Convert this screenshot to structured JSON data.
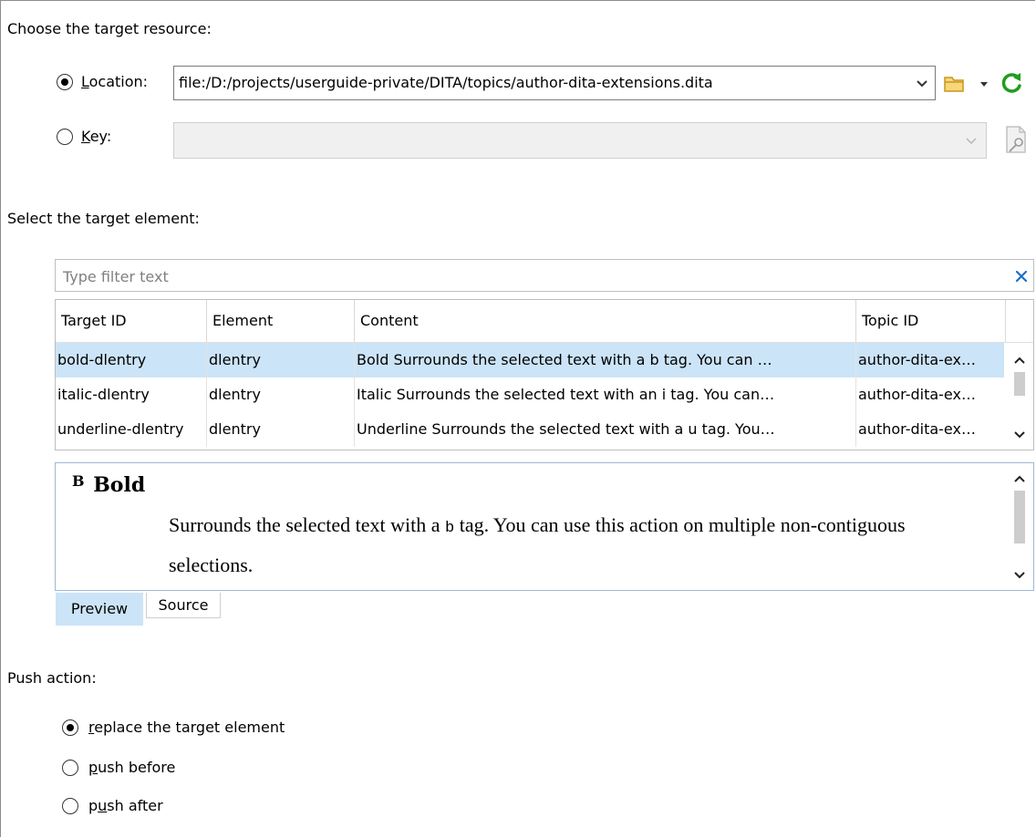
{
  "resource": {
    "heading": "Choose the target resource:",
    "location": {
      "label_accel": "L",
      "label_rest": "ocation:",
      "value": "file:/D:/projects/userguide-private/DITA/topics/author-dita-extensions.dita",
      "selected": true
    },
    "key": {
      "label_accel": "K",
      "label_rest": "ey:",
      "value": "",
      "selected": false
    }
  },
  "element": {
    "heading": "Select the target element:",
    "filter_placeholder": "Type filter text",
    "columns": [
      "Target ID",
      "Element",
      "Content",
      "Topic ID"
    ],
    "rows": [
      {
        "target_id": "bold-dlentry",
        "element": "dlentry",
        "content": "Bold Surrounds the selected text with a b tag. You can …",
        "topic_id": "author-dita-ex…",
        "selected": true
      },
      {
        "target_id": "italic-dlentry",
        "element": "dlentry",
        "content": "Italic Surrounds the selected text with an i tag. You can…",
        "topic_id": "author-dita-ex…",
        "selected": false
      },
      {
        "target_id": "underline-dlentry",
        "element": "dlentry",
        "content": "Underline Surrounds the selected text with a u tag. You…",
        "topic_id": "author-dita-ex…",
        "selected": false
      }
    ]
  },
  "preview": {
    "glyph": "B",
    "title": "Bold",
    "body_before": "Surrounds the selected text with a ",
    "body_code": "b",
    "body_after": " tag. You can use this action on multiple non-contiguous selections.",
    "tabs": [
      "Preview",
      "Source"
    ],
    "active_tab": "Preview"
  },
  "push": {
    "heading": "Push action:",
    "options": [
      {
        "accel": "r",
        "rest": "eplace the target element",
        "selected": true
      },
      {
        "accel": "p",
        "rest": "ush before",
        "selected": false,
        "prefix": ""
      },
      {
        "prefix": "p",
        "accel": "u",
        "rest": "sh after",
        "selected": false
      }
    ]
  },
  "colors": {
    "selection": "#cce4f7",
    "refresh_green": "#1f9d1f",
    "folder_yellow": "#e8b93a",
    "clear_blue": "#1e6fc8"
  }
}
